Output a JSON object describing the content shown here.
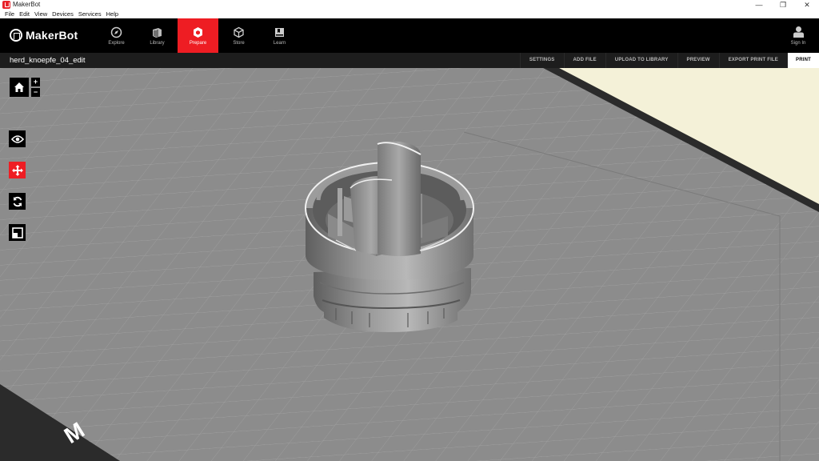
{
  "window": {
    "title": "MakerBot",
    "controls": [
      "—",
      "❐",
      "✕"
    ]
  },
  "menu": [
    "File",
    "Edit",
    "View",
    "Devices",
    "Services",
    "Help"
  ],
  "header": {
    "logo_text": "MakerBot",
    "nav": [
      {
        "label": "Explore",
        "icon": "compass-icon",
        "active": false
      },
      {
        "label": "Library",
        "icon": "library-icon",
        "active": false
      },
      {
        "label": "Prepare",
        "icon": "prepare-icon",
        "active": true
      },
      {
        "label": "Store",
        "icon": "cube-icon",
        "active": false
      },
      {
        "label": "Learn",
        "icon": "book-icon",
        "active": false
      }
    ],
    "signin_label": "Sign In"
  },
  "toolbar": {
    "file_name": "herd_knoepfe_04_edit",
    "actions": [
      "SETTINGS",
      "ADD FILE",
      "UPLOAD TO LIBRARY",
      "PREVIEW",
      "EXPORT PRINT FILE"
    ],
    "print_label": "PRINT"
  },
  "tools": {
    "zoom_in": "+",
    "zoom_out": "−",
    "items": [
      {
        "name": "view-icon",
        "active": false
      },
      {
        "name": "move-icon",
        "active": true
      },
      {
        "name": "rotate-icon",
        "active": false
      },
      {
        "name": "scale-icon",
        "active": false
      }
    ]
  },
  "colors": {
    "accent": "#ee1d23",
    "header_bg": "#000000",
    "toolbar_bg": "#1d1d1d",
    "plate": "#8c8c8c",
    "grid_line": "#a3a3a3",
    "floor": "#f4f1d8"
  }
}
